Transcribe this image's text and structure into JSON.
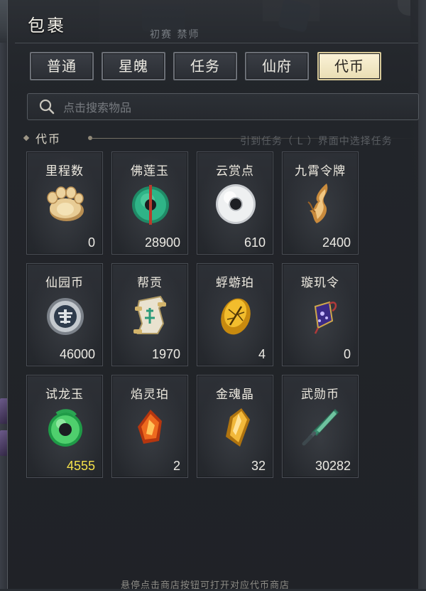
{
  "window": {
    "title": "包裹"
  },
  "background": {
    "top_faded_text": "初赛   禁师"
  },
  "tabs": [
    {
      "label": "普通",
      "active": false
    },
    {
      "label": "星魄",
      "active": false
    },
    {
      "label": "任务",
      "active": false
    },
    {
      "label": "仙府",
      "active": false
    },
    {
      "label": "代币",
      "active": true
    }
  ],
  "search": {
    "placeholder": "点击搜索物品",
    "value": ""
  },
  "section": {
    "label": "代币",
    "faded_hint": "引到任务（ L ）界面中选择任务"
  },
  "items": [
    {
      "name": "里程数",
      "count": "0",
      "icon": "paw-stone-icon",
      "count_color": "#eceae4"
    },
    {
      "name": "佛莲玉",
      "count": "28900",
      "icon": "jade-disc-icon",
      "count_color": "#eceae4"
    },
    {
      "name": "云赏点",
      "count": "610",
      "icon": "white-jade-ring-icon",
      "count_color": "#eceae4"
    },
    {
      "name": "九霄令牌",
      "count": "2400",
      "icon": "golden-flame-token-icon",
      "count_color": "#eceae4"
    },
    {
      "name": "仙园币",
      "count": "46000",
      "icon": "silver-coin-icon",
      "count_color": "#eceae4"
    },
    {
      "name": "帮贡",
      "count": "1970",
      "icon": "scroll-token-icon",
      "count_color": "#eceae4"
    },
    {
      "name": "蜉蝣珀",
      "count": "4",
      "icon": "amber-insect-icon",
      "count_color": "#eceae4"
    },
    {
      "name": "璇玑令",
      "count": "0",
      "icon": "purple-tablet-icon",
      "count_color": "#eceae4"
    },
    {
      "name": "试龙玉",
      "count": "4555",
      "icon": "green-dragon-jade-icon",
      "count_color": "#f5e14a"
    },
    {
      "name": "焰灵珀",
      "count": "2",
      "icon": "flame-crystal-icon",
      "count_color": "#eceae4"
    },
    {
      "name": "金魂晶",
      "count": "32",
      "icon": "gold-crystal-icon",
      "count_color": "#eceae4"
    },
    {
      "name": "武勋币",
      "count": "30282",
      "icon": "jade-blade-icon",
      "count_color": "#eceae4"
    }
  ],
  "footer": {
    "tip": "悬停点击商店按钮可打开对应代币商店"
  },
  "colors": {
    "active_tab_bg": "#fbf3d8",
    "highlight_count": "#f5e14a",
    "panel_bg": "#22252a"
  }
}
